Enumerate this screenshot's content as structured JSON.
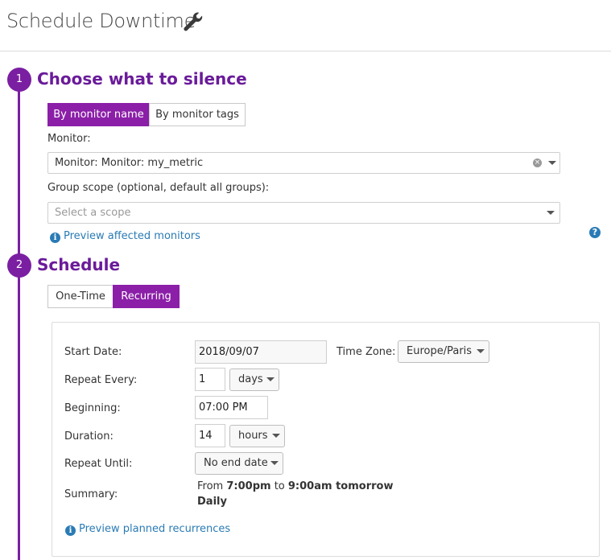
{
  "header": {
    "title": "Schedule Downtime",
    "icon": "wrench-icon"
  },
  "step1": {
    "number": "1",
    "title": "Choose what to silence",
    "mode_tabs": [
      {
        "label": "By monitor name",
        "active": true
      },
      {
        "label": "By monitor tags",
        "active": false
      }
    ],
    "monitor_label": "Monitor:",
    "monitor_value": "Monitor: Monitor: my_metric",
    "scope_label": "Group scope (optional, default all groups):",
    "scope_placeholder": "Select a scope",
    "preview_link": "Preview affected monitors"
  },
  "step2": {
    "number": "2",
    "title": "Schedule",
    "type_tabs": [
      {
        "label": "One-Time",
        "active": false
      },
      {
        "label": "Recurring",
        "active": true
      }
    ],
    "form": {
      "start_date_label": "Start Date:",
      "start_date_value": "2018/09/07",
      "time_zone_label": "Time Zone:",
      "time_zone_value": "Europe/Paris",
      "repeat_every_label": "Repeat Every:",
      "repeat_every_value": "1",
      "repeat_every_unit": "days",
      "beginning_label": "Beginning:",
      "beginning_value": "07:00 PM",
      "duration_label": "Duration:",
      "duration_value": "14",
      "duration_unit": "hours",
      "repeat_until_label": "Repeat Until:",
      "repeat_until_value": "No end date",
      "summary_label": "Summary:",
      "summary_from": "From",
      "summary_start": "7:00pm",
      "summary_to": "to",
      "summary_end": "9:00am tomorrow",
      "summary_frequency": "Daily",
      "preview_link": "Preview planned recurrences"
    }
  },
  "colors": {
    "accent": "#8b1fa8",
    "title": "#6a1b9a",
    "link": "#2a7bb5"
  }
}
